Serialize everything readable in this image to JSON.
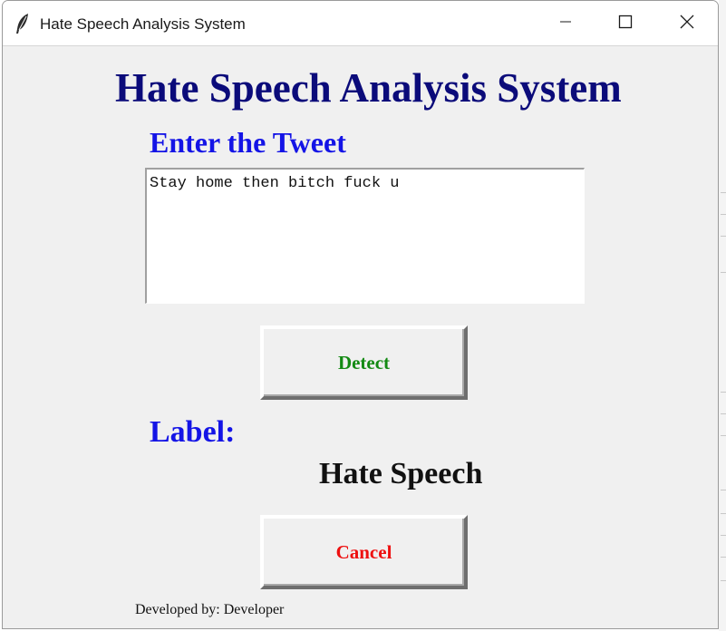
{
  "window": {
    "title": "Hate Speech Analysis System",
    "controls": {
      "minimize": "minimize-icon",
      "maximize": "maximize-icon",
      "close": "close-icon"
    }
  },
  "main": {
    "heading": "Hate Speech Analysis System",
    "input_label": "Enter the Tweet",
    "tweet_text": "Stay home then bitch fuck u",
    "detect_label": "Detect",
    "result_label": "Label:",
    "result_value": "Hate Speech",
    "cancel_label": "Cancel",
    "footer": "Developed by: Developer"
  },
  "colors": {
    "heading": "#0b0b7a",
    "labels": "#1414e6",
    "detect": "#138a13",
    "cancel": "#ee1010",
    "window_bg": "#f0f0f0"
  }
}
